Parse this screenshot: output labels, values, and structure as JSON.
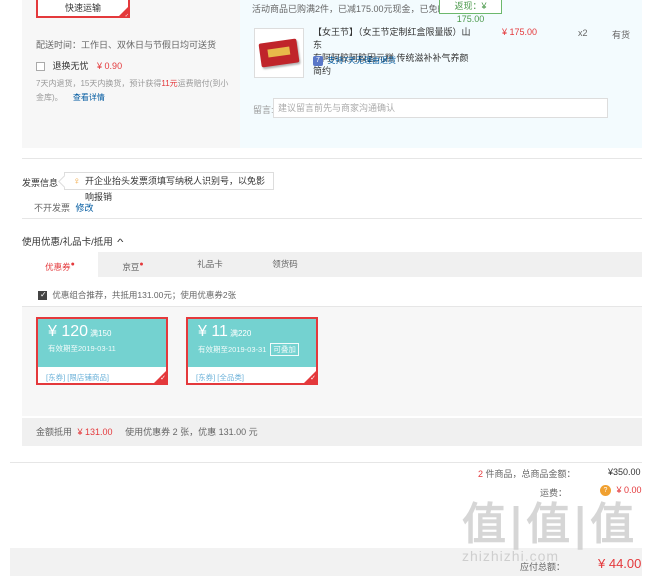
{
  "shipping": {
    "express_label": "快速运输",
    "delivery_time": "配送时间：工作日、双休日与节假日均可送货",
    "return_worry_label": "退换无忧",
    "return_worry_price": "¥ 0.90",
    "return_desc_a": "7天内退货，15天内换货，预计获得",
    "return_desc_amount": "11元",
    "return_desc_b": "运费赔付(到小",
    "return_desc_c": "金库)。",
    "view_details": "查看详情"
  },
  "product": {
    "promo_text": "活动商品已购满2件，已减175.00元现金，已免邮",
    "rebate_label": "返现：¥ 175.00",
    "title_line1": "【女王节】（女王节定制红盒限量版）山东",
    "title_line2": "东阿阿胶阿胶固元糕 传统滋补补气养颜简约",
    "price": "¥ 175.00",
    "qty": "x2",
    "stock": "有货",
    "seven_day_icon": "7",
    "seven_day_text": "支持7天无理由退货",
    "msg_label": "留言:",
    "msg_placeholder": "建议留言前先与商家沟通确认"
  },
  "invoice": {
    "title": "发票信息",
    "tip": "开企业抬头发票须填写纳税人识别号，以免影响报销",
    "status": "不开发票",
    "modify": "修改"
  },
  "coupons": {
    "section_title": "使用优惠/礼品卡/抵用",
    "collapse_icon": "chevron-up-icon",
    "tabs": [
      {
        "label": "优惠券",
        "dot": "●"
      },
      {
        "label": "京豆",
        "dot": "●"
      },
      {
        "label": "礼品卡",
        "dot": ""
      },
      {
        "label": "领货码",
        "dot": ""
      }
    ],
    "recommend_text": "优惠组合推荐，共抵用131.00元；使用优惠券2张",
    "items": [
      {
        "amount": "¥ 120",
        "condition": "满150",
        "expiry": "有效期至2019-03-11",
        "stackable": "",
        "scope": "[东券] [限店铺商品]"
      },
      {
        "amount": "¥ 11",
        "condition": "满220",
        "expiry": "有效期至2019-03-31",
        "stackable": "可叠加",
        "scope": "[东券] [全品类]"
      }
    ],
    "summary_label": "金额抵用",
    "summary_amount": "¥ 131.00",
    "summary_detail": "使用优惠券 2 张，优惠 131.00 元"
  },
  "totals": {
    "item_count": "2",
    "item_count_suffix": "件商品，总商品金额：",
    "goods_total": "¥350.00",
    "freight_label": "运费：",
    "freight_icon": "yun-icon",
    "freight_value": "¥ 0.00",
    "payable_label": "应付总额：",
    "payable_value": "¥ 44.00"
  },
  "watermark": {
    "big": "值|值|值",
    "small": "zhizhizhi.com"
  },
  "colors": {
    "accent_red": "#e4393c",
    "link_blue": "#005aa0",
    "coupon_teal": "#74d2d0",
    "rebate_green": "#4c9a4c"
  }
}
